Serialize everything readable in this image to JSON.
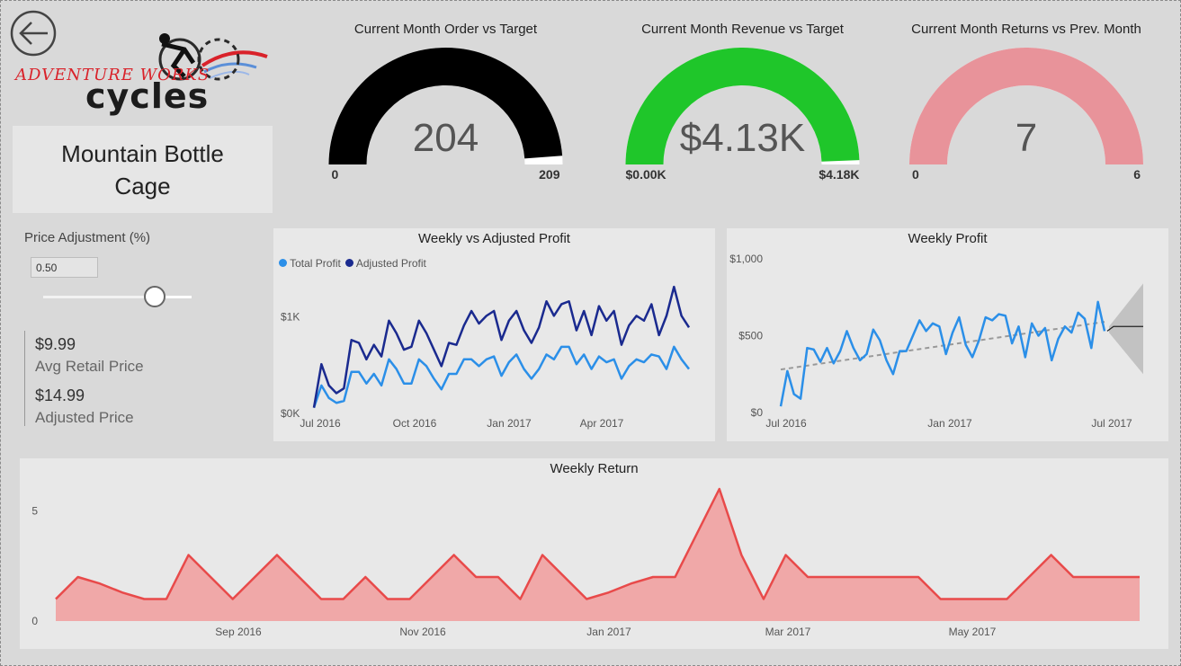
{
  "logo": {
    "line1": "ADVENTURE WORKS",
    "line2": "cycles"
  },
  "product": {
    "name": "Mountain Bottle Cage"
  },
  "gauges": [
    {
      "title": "Current Month Order vs Target",
      "value_label": "204",
      "value": 204,
      "min_label": "0",
      "max_label": "209",
      "min": 0,
      "max": 209,
      "color": "#000000"
    },
    {
      "title": "Current Month Revenue vs Target",
      "value_label": "$4.13K",
      "value": 4.13,
      "min_label": "$0.00K",
      "max_label": "$4.18K",
      "min": 0,
      "max": 4.18,
      "color": "#1fc62a"
    },
    {
      "title": "Current Month Returns vs Prev. Month",
      "value_label": "7",
      "value": 7,
      "min_label": "0",
      "max_label": "6",
      "min": 0,
      "max": 6,
      "color": "#e8939a"
    }
  ],
  "price_adjustment": {
    "label": "Price Adjustment (%)",
    "value": "0.50",
    "slider_fraction": 0.75
  },
  "kpis": {
    "avg_retail_value": "$9.99",
    "avg_retail_label": "Avg Retail Price",
    "adjusted_value": "$14.99",
    "adjusted_label": "Adjusted Price"
  },
  "chart_data": [
    {
      "type": "line",
      "title": "Weekly vs Adjusted Profit",
      "legend": [
        "Total Profit",
        "Adjusted Profit"
      ],
      "legend_position": "top-left",
      "colors": [
        "#2b8fe8",
        "#1a2a8f"
      ],
      "x_ticks": [
        "Jul 2016",
        "Oct 2016",
        "Jan 2017",
        "Apr 2017"
      ],
      "y_ticks": [
        "$0K",
        "$1K"
      ],
      "ylim": [
        0,
        1.05
      ],
      "series": [
        {
          "name": "Total Profit",
          "values": [
            0.05,
            0.28,
            0.15,
            0.1,
            0.12,
            0.42,
            0.42,
            0.3,
            0.4,
            0.28,
            0.55,
            0.45,
            0.3,
            0.3,
            0.55,
            0.48,
            0.35,
            0.24,
            0.4,
            0.4,
            0.55,
            0.55,
            0.48,
            0.55,
            0.58,
            0.38,
            0.52,
            0.6,
            0.45,
            0.35,
            0.45,
            0.6,
            0.55,
            0.68,
            0.68,
            0.5,
            0.6,
            0.45,
            0.58,
            0.52,
            0.55,
            0.35,
            0.48,
            0.55,
            0.52,
            0.6,
            0.58,
            0.45,
            0.68,
            0.55,
            0.45
          ]
        },
        {
          "name": "Adjusted Profit",
          "values": [
            0.05,
            0.5,
            0.28,
            0.2,
            0.25,
            0.75,
            0.72,
            0.55,
            0.7,
            0.58,
            0.95,
            0.82,
            0.65,
            0.68,
            0.95,
            0.82,
            0.65,
            0.48,
            0.72,
            0.7,
            0.9,
            1.05,
            0.92,
            1.0,
            1.05,
            0.75,
            0.95,
            1.05,
            0.85,
            0.72,
            0.88,
            1.15,
            1.0,
            1.12,
            1.15,
            0.85,
            1.05,
            0.8,
            1.1,
            0.95,
            1.05,
            0.7,
            0.9,
            1.0,
            0.95,
            1.12,
            0.8,
            1.0,
            1.3,
            1.0,
            0.88
          ]
        }
      ]
    },
    {
      "type": "line",
      "title": "Weekly Profit",
      "color": "#2b8fe8",
      "x_ticks": [
        "Jul 2016",
        "Jan 2017",
        "Jul 2017"
      ],
      "y_ticks": [
        "$0",
        "$500",
        "$1,000"
      ],
      "ylim": [
        0,
        1000
      ],
      "values": [
        40,
        270,
        120,
        90,
        420,
        410,
        330,
        420,
        320,
        400,
        530,
        420,
        340,
        380,
        540,
        470,
        340,
        250,
        400,
        400,
        500,
        600,
        530,
        580,
        560,
        380,
        520,
        620,
        440,
        360,
        470,
        620,
        600,
        640,
        630,
        450,
        560,
        360,
        580,
        500,
        550,
        340,
        480,
        560,
        520,
        650,
        610,
        420,
        720,
        530
      ],
      "trend": [
        280,
        590
      ],
      "forecast": {
        "center": 560,
        "upper": 840,
        "lower": 250
      }
    },
    {
      "type": "area",
      "title": "Weekly Return",
      "color": "#e84a4a",
      "fill": "#f0a8a8",
      "x_ticks": [
        "Sep 2016",
        "Nov 2016",
        "Jan 2017",
        "Mar 2017",
        "May 2017"
      ],
      "y_ticks": [
        "0",
        "5"
      ],
      "ylim": [
        0,
        6
      ],
      "values": [
        1,
        2,
        1.7,
        1.3,
        1,
        1,
        3,
        2,
        1,
        2,
        3,
        2,
        1,
        1,
        2,
        1,
        1,
        2,
        3,
        2,
        2,
        1,
        3,
        2,
        1,
        1.3,
        1.7,
        2,
        2,
        4,
        6,
        3,
        1,
        3,
        2,
        2,
        2,
        2,
        2,
        2,
        1,
        1,
        1,
        1,
        2,
        3,
        2,
        2,
        2,
        2
      ]
    }
  ]
}
